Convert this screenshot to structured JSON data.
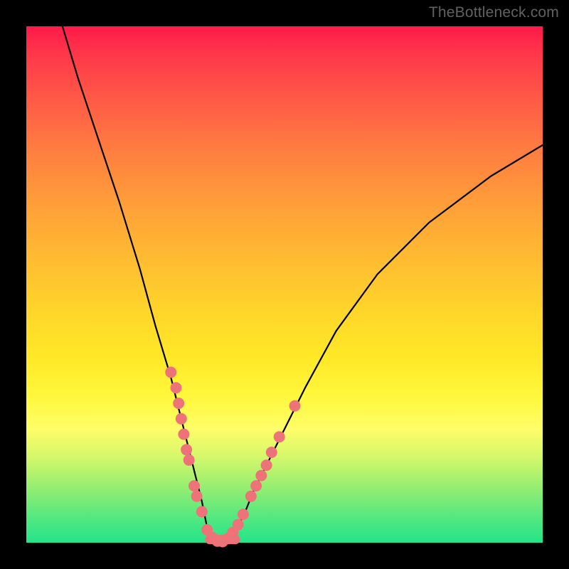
{
  "watermark": "TheBottleneck.com",
  "chart_data": {
    "type": "line",
    "title": "",
    "xlabel": "",
    "ylabel": "",
    "xlim": [
      0,
      100
    ],
    "ylim": [
      0,
      100
    ],
    "series": [
      {
        "name": "bottleneck-curve",
        "x": [
          7,
          10,
          14,
          18,
          22,
          25,
          28,
          30,
          32,
          34,
          35,
          36,
          37,
          38,
          39,
          40,
          42,
          44,
          48,
          54,
          60,
          68,
          78,
          90,
          100
        ],
        "values": [
          100,
          90,
          78,
          66,
          53,
          42,
          32,
          24,
          16,
          8,
          3,
          1,
          0,
          0,
          1,
          2,
          5,
          10,
          18,
          30,
          41,
          52,
          62,
          71,
          77
        ]
      }
    ],
    "markers": {
      "name": "highlight-dots",
      "color": "#ee7378",
      "points": [
        {
          "x": 28,
          "y": 33
        },
        {
          "x": 29,
          "y": 30
        },
        {
          "x": 29.5,
          "y": 27
        },
        {
          "x": 30,
          "y": 24
        },
        {
          "x": 30.5,
          "y": 21
        },
        {
          "x": 31,
          "y": 18
        },
        {
          "x": 31.5,
          "y": 16
        },
        {
          "x": 32.5,
          "y": 11
        },
        {
          "x": 33,
          "y": 9
        },
        {
          "x": 34,
          "y": 6
        },
        {
          "x": 35,
          "y": 2.5
        },
        {
          "x": 36,
          "y": 1
        },
        {
          "x": 37,
          "y": 0.3
        },
        {
          "x": 38,
          "y": 0.2
        },
        {
          "x": 39,
          "y": 0.8
        },
        {
          "x": 40,
          "y": 2
        },
        {
          "x": 41,
          "y": 3.5
        },
        {
          "x": 42,
          "y": 5.5
        },
        {
          "x": 43.5,
          "y": 9
        },
        {
          "x": 44.5,
          "y": 11
        },
        {
          "x": 45.5,
          "y": 13
        },
        {
          "x": 46.5,
          "y": 15
        },
        {
          "x": 47.5,
          "y": 17.5
        },
        {
          "x": 49,
          "y": 20.5
        },
        {
          "x": 52,
          "y": 26.5
        }
      ]
    }
  }
}
